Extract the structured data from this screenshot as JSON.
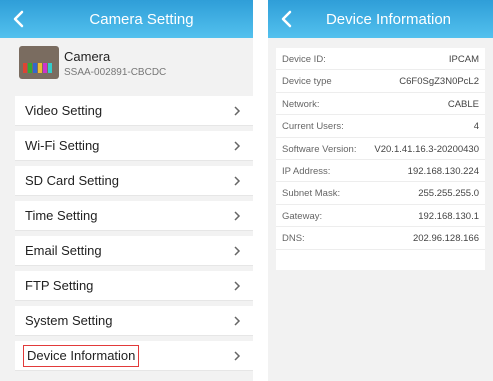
{
  "left": {
    "title": "Camera Setting",
    "camera": {
      "name": "Camera",
      "id": "SSAA-002891-CBCDC"
    },
    "menu": [
      {
        "label": "Video Setting"
      },
      {
        "label": "Wi-Fi Setting"
      },
      {
        "label": "SD Card Setting"
      },
      {
        "label": "Time Setting"
      },
      {
        "label": "Email Setting"
      },
      {
        "label": "FTP Setting"
      },
      {
        "label": "System Setting"
      },
      {
        "label": "Device Information"
      }
    ]
  },
  "right": {
    "title": "Device Information",
    "rows": [
      {
        "key": "Device ID:",
        "value": "IPCAM"
      },
      {
        "key": "Device type",
        "value": "C6F0SgZ3N0PcL2"
      },
      {
        "key": "Network:",
        "value": "CABLE"
      },
      {
        "key": "Current Users:",
        "value": "4"
      },
      {
        "key": "Software Version:",
        "value": "V20.1.41.16.3-20200430"
      },
      {
        "key": "IP Address:",
        "value": "192.168.130.224"
      },
      {
        "key": "Subnet Mask:",
        "value": "255.255.255.0"
      },
      {
        "key": "Gateway:",
        "value": "192.168.130.1"
      },
      {
        "key": "DNS:",
        "value": "202.96.128.166"
      }
    ]
  },
  "icons": {
    "back": "chevron-left-icon",
    "menu_arrow": "chevron-right-icon"
  },
  "colors": {
    "header_top": "#2f9ed8",
    "header_bottom": "#53c1ee",
    "highlight_border": "#e23a3a"
  }
}
